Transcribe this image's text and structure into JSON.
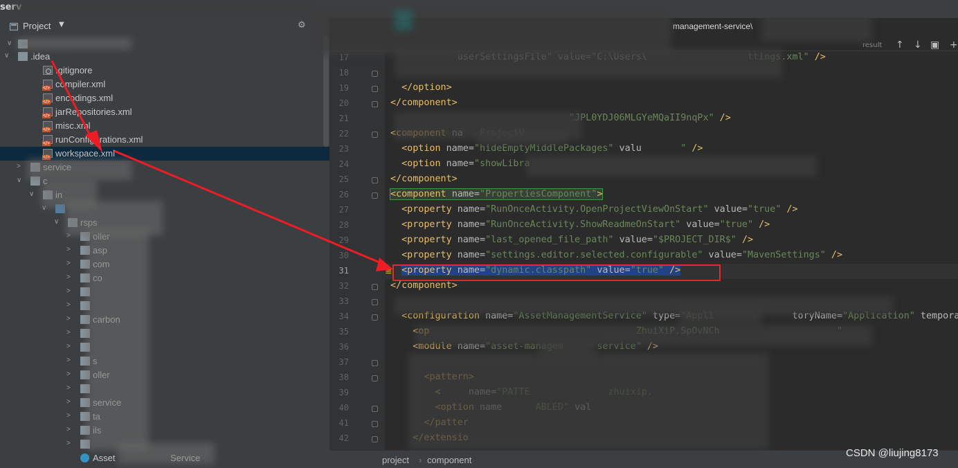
{
  "app": {
    "title": "serv",
    "path_fragment": "management-service\\"
  },
  "project_panel": {
    "view_label": "Project",
    "tree": [
      {
        "label": ".idea",
        "icon": "folder-icon"
      },
      {
        "label": ".gitignore",
        "icon": "git-icon"
      },
      {
        "label": "compiler.xml",
        "icon": "xml-icon"
      },
      {
        "label": "encodings.xml",
        "icon": "xml-icon"
      },
      {
        "label": "jarRepositories.xml",
        "icon": "xml-icon"
      },
      {
        "label": "misc.xml",
        "icon": "xml-icon"
      },
      {
        "label": "runConfigurations.xml",
        "icon": "xml-icon"
      },
      {
        "label": "workspace.xml",
        "icon": "xml-icon",
        "selected": true
      },
      {
        "label": "service"
      },
      {
        "label": "c"
      },
      {
        "label": "in"
      },
      {
        "label": ""
      },
      {
        "label": "rsps"
      },
      {
        "label": "oller"
      },
      {
        "label": "asp"
      },
      {
        "label": "com"
      },
      {
        "label": "co"
      },
      {
        "label": ""
      },
      {
        "label": ""
      },
      {
        "label": "carbon"
      },
      {
        "label": ""
      },
      {
        "label": ""
      },
      {
        "label": "s"
      },
      {
        "label": "oller"
      },
      {
        "label": ""
      },
      {
        "label": "service"
      },
      {
        "label": "ta"
      },
      {
        "label": "ils"
      },
      {
        "label": ""
      },
      {
        "label": "Asset",
        "suffix": "Service"
      }
    ]
  },
  "editor": {
    "toolbar": {
      "result_label": "result"
    },
    "lines": [
      {
        "no": "17",
        "html": "            <span class='attr'>userSettingsFile\" value=\"C:\\Users\\</span>                  <span class='val'>ttings.xml\"</span> <span class='tag'>/&gt;</span>"
      },
      {
        "no": "18",
        "html": ""
      },
      {
        "no": "19",
        "html": "  <span class='tag'>&lt;/option&gt;</span>"
      },
      {
        "no": "20",
        "html": "<span class='tag'>&lt;/component&gt;</span>"
      },
      {
        "no": "21",
        "html": "                                <span class='val'>\"JPL0YDJ06MLGYeMQaII9nqPx\"</span> <span class='tag'>/&gt;</span>"
      },
      {
        "no": "22",
        "html": "<span class='tag'>&lt;component</span> <span class='attr'>na</span>   <span class='val'>ProjectV</span>"
      },
      {
        "no": "23",
        "html": "  <span class='tag'>&lt;option</span> <span class='attr'>name=</span><span class='val'>\"hideEmptyMiddlePackages\"</span> <span class='attr'>valu</span>       <span class='val'>\"</span> <span class='tag'>/&gt;</span>"
      },
      {
        "no": "24",
        "html": "  <span class='tag'>&lt;option</span> <span class='attr'>name=</span><span class='val'>\"showLibra</span>"
      },
      {
        "no": "25",
        "html": "<span class='tag'>&lt;/component&gt;</span>"
      },
      {
        "no": "26",
        "html": "<span class='box-green'><span class='tag'>&lt;component</span> <span class='attr'>name=</span><span class='val'>\"PropertiesComponent\"</span><span class='tag'>&gt;</span></span>"
      },
      {
        "no": "27",
        "html": "  <span class='tag'>&lt;property</span> <span class='attr'>name=</span><span class='val'>\"RunOnceActivity.OpenProjectViewOnStart\"</span> <span class='attr'>value=</span><span class='val'>\"true\"</span> <span class='tag'>/&gt;</span>"
      },
      {
        "no": "28",
        "html": "  <span class='tag'>&lt;property</span> <span class='attr'>name=</span><span class='val'>\"RunOnceActivity.ShowReadmeOnStart\"</span> <span class='attr'>value=</span><span class='val'>\"true\"</span> <span class='tag'>/&gt;</span>"
      },
      {
        "no": "29",
        "html": "  <span class='tag'>&lt;property</span> <span class='attr'>name=</span><span class='val'>\"last_opened_file_path\"</span> <span class='attr'>value=</span><span class='val'>\"$PROJECT_DIR$\"</span> <span class='tag'>/&gt;</span>"
      },
      {
        "no": "30",
        "html": "  <span class='tag'>&lt;property</span> <span class='attr'>name=</span><span class='val'>\"settings.editor.selected.configurable\"</span> <span class='attr'>value=</span><span class='val'>\"MavenSettings\"</span> <span class='tag'>/&gt;</span>"
      },
      {
        "no": "31",
        "html": "  <span class='selection'><span class='tag'>&lt;property</span> <span class='attr'>name=</span><span class='val'>\"dynamic.classpath\"</span> <span class='attr'>value=</span><span class='val'>\"true\"</span> <span class='tag'>/&gt;</span></span>"
      },
      {
        "no": "32",
        "html": "<span class='tag'>&lt;/component&gt;</span>"
      },
      {
        "no": "33",
        "html": ""
      },
      {
        "no": "34",
        "html": "  <span class='tag'>&lt;configuration</span> <span class='attr'>name=</span><span class='val'>\"AssetManagementService\"</span> <span class='attr'>type=</span><span class='val'>\"Appli</span>              <span class='attr'>toryName=</span><span class='val'>\"Application\"</span> <span class='attr'>temporary=</span><span class='val'>\"</span>"
      },
      {
        "no": "35",
        "html": "    <span class='tag'>&lt;op</span>                                     <span class='val'>ZhuiXiP.SpOvNCh</span>                     <span class='val'>\"</span>"
      },
      {
        "no": "36",
        "html": "    <span class='tag'>&lt;module</span> <span class='attr'>name=</span><span class='val'>\"asset-managem</span>      <span class='val'>service\"</span> <span class='tag'>/&gt;</span>"
      },
      {
        "no": "37",
        "html": ""
      },
      {
        "no": "38",
        "html": "      <span class='tag'>&lt;pattern&gt;</span>"
      },
      {
        "no": "39",
        "html": "        <span class='tag'>&lt;</span>     <span class='attr'>name=</span><span class='val'>\"PATTE</span>              <span class='val'>zhuixip.</span>"
      },
      {
        "no": "40",
        "html": "        <span class='tag'>&lt;option</span> <span class='attr'>name</span>      <span class='val'>ABLED\"</span> <span class='attr'>val</span>"
      },
      {
        "no": "41",
        "html": "      <span class='tag'>&lt;/patter</span>"
      },
      {
        "no": "42",
        "html": "    <span class='tag'>&lt;/extensio</span>"
      }
    ]
  },
  "breadcrumb": {
    "items": [
      "project",
      "component"
    ]
  },
  "watermark": "CSDN @liujing8173"
}
